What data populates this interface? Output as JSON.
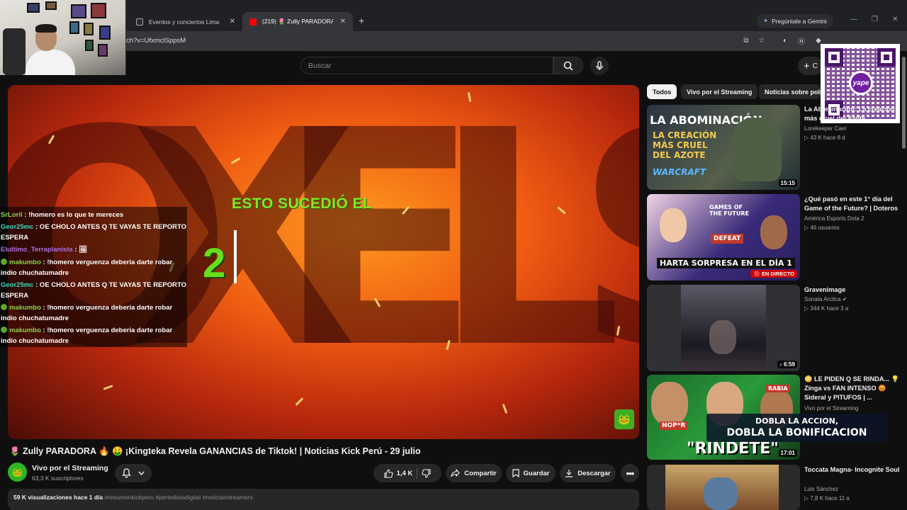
{
  "browser": {
    "tabs": [
      {
        "label": "Eventos y conciertos Lima"
      },
      {
        "label": "(219) 🌷 Zully PARADORA 🔥 🤑"
      }
    ],
    "new_tab_symbol": "+",
    "gemini_label": "Pregúntale a Gemini",
    "url": "ch?v=UfxmclSppsM"
  },
  "youtube": {
    "search_placeholder": "Buscar",
    "create_label": "C"
  },
  "qr": {
    "logo_text": "yape"
  },
  "video": {
    "overlay_line1": "ESTO SUCEDIÓ EL",
    "overlay_number": "2"
  },
  "chat": [
    {
      "user": "SrLoril",
      "color": "#8fd14f",
      "text": " : !homero es lo que te mereces",
      "icon": false
    },
    {
      "user": "Geor25mc",
      "color": "#3fd8c4",
      "text": " : OE CHOLO ANTES Q TE VAYAS TE REPORTO ESPERA",
      "icon": false
    },
    {
      "user": "Elultimo_Terraplanista",
      "color": "#b06ee6",
      "text": " : 🖼",
      "icon": false
    },
    {
      "user": "makumbo",
      "color": "#8fd14f",
      "text": " : !homero verguenza deberia darte robar indio chuchatumadre",
      "icon": true
    },
    {
      "user": "Geor25mc",
      "color": "#3fd8c4",
      "text": " : OE CHOLO ANTES Q TE VAYAS TE REPORTO ESPERA",
      "icon": false
    },
    {
      "user": "makumbo",
      "color": "#8fd14f",
      "text": " : !homero verguenza deberia darte robar indio chuchatumadre",
      "icon": true
    },
    {
      "user": "makumbo",
      "color": "#8fd14f",
      "text": " : !homero verguenza deberia darte robar indio chuchatumadre",
      "icon": true
    }
  ],
  "watch": {
    "title": "🌷 Zully PARADORA 🔥 🤑 ¡Kingteka Revela GANANCIAS de Tiktok! | Noticias Kick Perú - 29 julio",
    "channel": "Vivo por el Streaming",
    "subscribers": "63,3 K suscriptores",
    "likes": "1,4 K",
    "share_label": "Compartir",
    "save_label": "Guardar",
    "download_label": "Descargar",
    "desc_stats": "59 K visualizaciones  hace 1 día",
    "desc_tags": "#resumenkickperu #periodistadigital #noticiasstreamers"
  },
  "chips": [
    "Todos",
    "Vivo por el Streaming",
    "Noticias sobre polí"
  ],
  "related": [
    {
      "title": "La Abominación: La creación más cruel del Azote",
      "channel": "Lorekeeper Cael",
      "meta": "▷ 43 K  hace 8 d",
      "duration": "15:15",
      "thumb_text": [
        "LA ABOMINACIÓN",
        "LA CREACIÓN",
        "MÁS CRUEL",
        "DEL AZOTE",
        "WARCRAFT"
      ]
    },
    {
      "title": "¿Qué pasó en este 1° día del Game of the Future? | Doteros",
      "channel": "América Esports Dota 2",
      "meta": "▷ 46 usuarios",
      "live": "🔴 EN DIRECTO",
      "thumb_text": [
        "GAMES OF THE FUTURE",
        "DEFEAT",
        "HARTA SORPRESA EN EL DÍA 1"
      ]
    },
    {
      "title": "Gravenimage",
      "channel": "Sonata Arctica ✔",
      "meta": "▷ 344 K  hace 3 a",
      "duration": "♪ 6:59"
    },
    {
      "title": "😳 LE PIDEN Q SE RINDA... 💡 Zinga vs FAN INTENSO 😡 Sideral y PITUFOS | ...",
      "channel": "Vivo por el Streaming",
      "meta": "",
      "duration": "17:01",
      "thumb_text": [
        "RABIA",
        "NOP*R",
        "\"RINDETE\""
      ]
    },
    {
      "title": "Toccata Magna- Incognite Soul",
      "channel": "Luis Sánchez",
      "meta": "▷ 7,8 K  hace 11 a"
    }
  ],
  "ad_overlay": {
    "line1": "DOBLA LA ACCION,",
    "line2": "DOBLA LA BONIFICACION"
  }
}
